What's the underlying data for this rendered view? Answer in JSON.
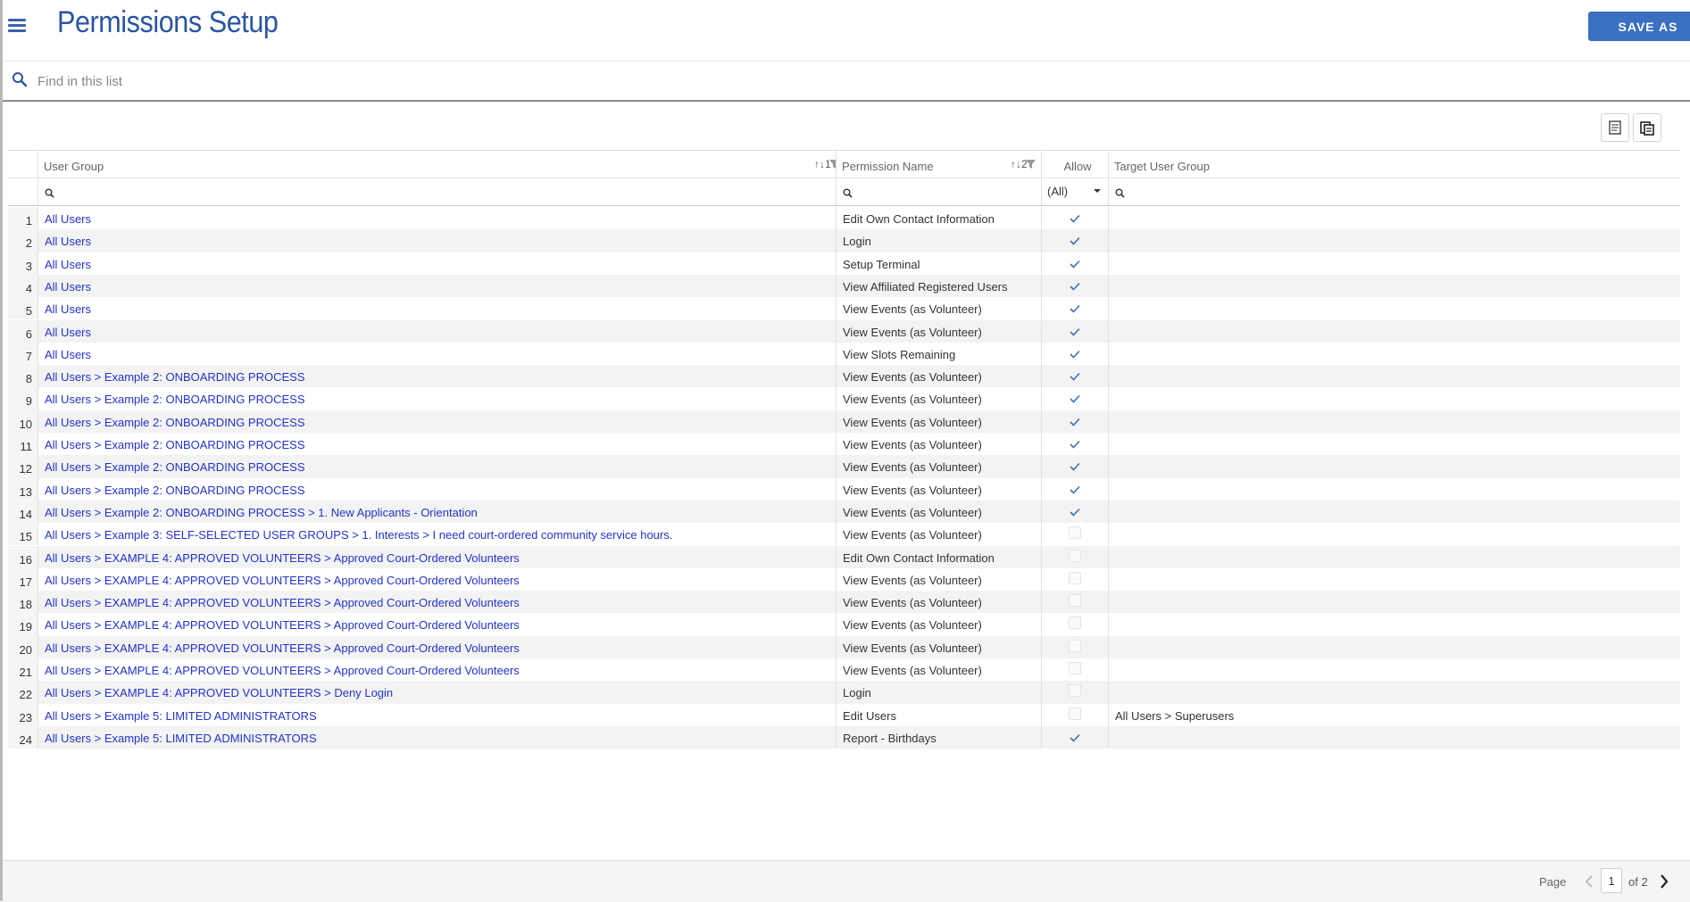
{
  "header": {
    "title": "Permissions Setup",
    "save_as_label": "SAVE AS"
  },
  "search": {
    "placeholder": "Find in this list"
  },
  "toolbar": {
    "export_icon": "spreadsheet-export-icon",
    "copy_icon": "copy-icon"
  },
  "grid": {
    "columns": {
      "user_group": "User Group",
      "user_group_sort": "1",
      "permission_name": "Permission Name",
      "permission_name_sort": "2",
      "allow": "Allow",
      "target_user_group": "Target User Group"
    },
    "allow_filter": "(All)",
    "rows": [
      {
        "num": "1",
        "user_group": "All Users",
        "permission": "Edit Own Contact Information",
        "allow": true,
        "target": ""
      },
      {
        "num": "2",
        "user_group": "All Users",
        "permission": "Login",
        "allow": true,
        "target": ""
      },
      {
        "num": "3",
        "user_group": "All Users",
        "permission": "Setup Terminal",
        "allow": true,
        "target": ""
      },
      {
        "num": "4",
        "user_group": "All Users",
        "permission": "View Affiliated Registered Users",
        "allow": true,
        "target": ""
      },
      {
        "num": "5",
        "user_group": "All Users",
        "permission": "View Events (as Volunteer)",
        "allow": true,
        "target": ""
      },
      {
        "num": "6",
        "user_group": "All Users",
        "permission": "View Events (as Volunteer)",
        "allow": true,
        "target": ""
      },
      {
        "num": "7",
        "user_group": "All Users",
        "permission": "View Slots Remaining",
        "allow": true,
        "target": ""
      },
      {
        "num": "8",
        "user_group": "All Users > Example 2: ONBOARDING PROCESS",
        "permission": "View Events (as Volunteer)",
        "allow": true,
        "target": ""
      },
      {
        "num": "9",
        "user_group": "All Users > Example 2: ONBOARDING PROCESS",
        "permission": "View Events (as Volunteer)",
        "allow": true,
        "target": ""
      },
      {
        "num": "10",
        "user_group": "All Users > Example 2: ONBOARDING PROCESS",
        "permission": "View Events (as Volunteer)",
        "allow": true,
        "target": ""
      },
      {
        "num": "11",
        "user_group": "All Users > Example 2: ONBOARDING PROCESS",
        "permission": "View Events (as Volunteer)",
        "allow": true,
        "target": ""
      },
      {
        "num": "12",
        "user_group": "All Users > Example 2: ONBOARDING PROCESS",
        "permission": "View Events (as Volunteer)",
        "allow": true,
        "target": ""
      },
      {
        "num": "13",
        "user_group": "All Users > Example 2: ONBOARDING PROCESS",
        "permission": "View Events (as Volunteer)",
        "allow": true,
        "target": ""
      },
      {
        "num": "14",
        "user_group": "All Users > Example 2: ONBOARDING PROCESS > 1. New Applicants - Orientation",
        "permission": "View Events (as Volunteer)",
        "allow": true,
        "target": ""
      },
      {
        "num": "15",
        "user_group": "All Users > Example 3: SELF-SELECTED USER GROUPS > 1. Interests > I need court-ordered community service hours.",
        "permission": "View Events (as Volunteer)",
        "allow": false,
        "target": ""
      },
      {
        "num": "16",
        "user_group": "All Users > EXAMPLE 4: APPROVED VOLUNTEERS > Approved Court-Ordered Volunteers",
        "permission": "Edit Own Contact Information",
        "allow": false,
        "target": ""
      },
      {
        "num": "17",
        "user_group": "All Users > EXAMPLE 4: APPROVED VOLUNTEERS > Approved Court-Ordered Volunteers",
        "permission": "View Events (as Volunteer)",
        "allow": false,
        "target": ""
      },
      {
        "num": "18",
        "user_group": "All Users > EXAMPLE 4: APPROVED VOLUNTEERS > Approved Court-Ordered Volunteers",
        "permission": "View Events (as Volunteer)",
        "allow": false,
        "target": ""
      },
      {
        "num": "19",
        "user_group": "All Users > EXAMPLE 4: APPROVED VOLUNTEERS > Approved Court-Ordered Volunteers",
        "permission": "View Events (as Volunteer)",
        "allow": false,
        "target": ""
      },
      {
        "num": "20",
        "user_group": "All Users > EXAMPLE 4: APPROVED VOLUNTEERS > Approved Court-Ordered Volunteers",
        "permission": "View Events (as Volunteer)",
        "allow": false,
        "target": ""
      },
      {
        "num": "21",
        "user_group": "All Users > EXAMPLE 4: APPROVED VOLUNTEERS > Approved Court-Ordered Volunteers",
        "permission": "View Events (as Volunteer)",
        "allow": false,
        "target": ""
      },
      {
        "num": "22",
        "user_group": "All Users > EXAMPLE 4: APPROVED VOLUNTEERS > Deny Login",
        "permission": "Login",
        "allow": false,
        "target": ""
      },
      {
        "num": "23",
        "user_group": "All Users > Example 5: LIMITED ADMINISTRATORS",
        "permission": "Edit Users",
        "allow": false,
        "target": "All Users > Superusers"
      },
      {
        "num": "24",
        "user_group": "All Users > Example 5: LIMITED ADMINISTRATORS",
        "permission": "Report - Birthdays",
        "allow": true,
        "target": ""
      }
    ]
  },
  "pager": {
    "label": "Page",
    "current": "1",
    "of_label": "of 2"
  },
  "colors": {
    "accent": "#3a6fc2",
    "title": "#2a55a0",
    "link": "#2233cc",
    "check": "#3a6fc2"
  }
}
